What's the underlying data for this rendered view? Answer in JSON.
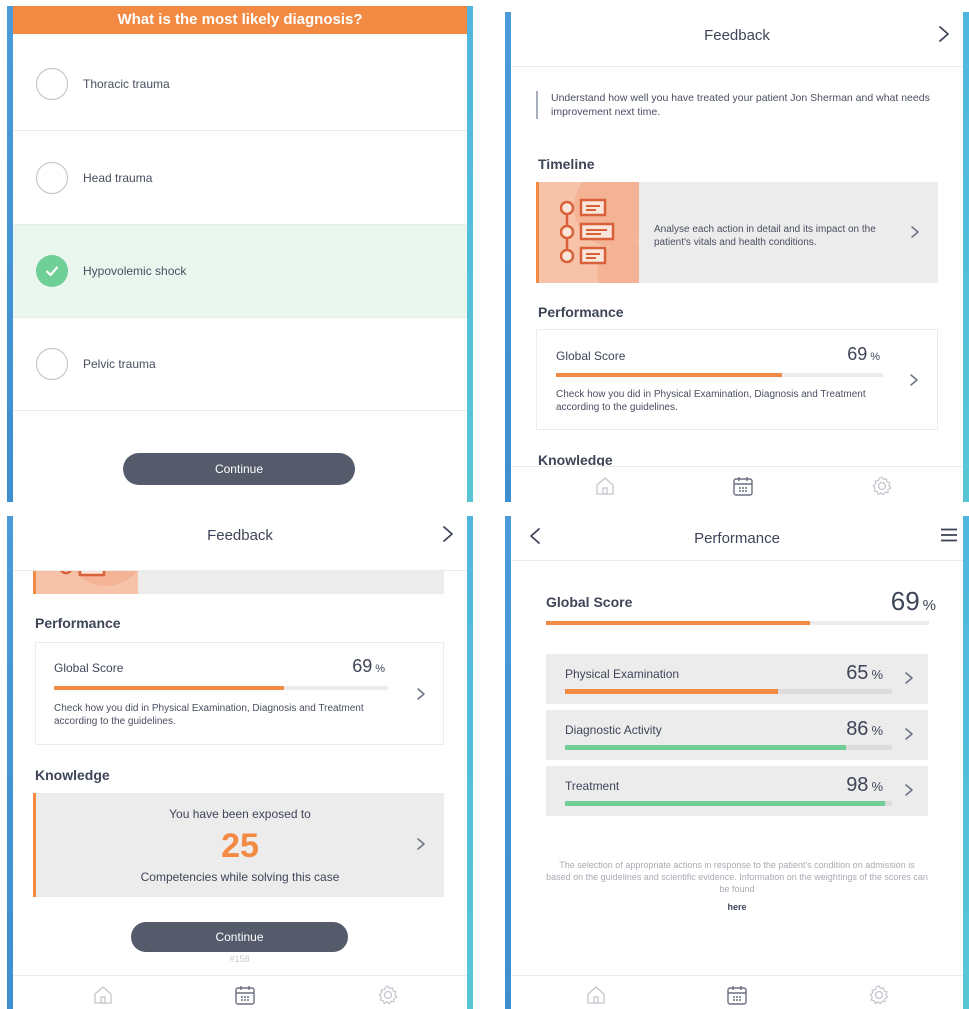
{
  "colors": {
    "accent": "#f28a44",
    "success": "#6fcf97",
    "button": "#555b6b",
    "card": "#ececec"
  },
  "quiz": {
    "question": "What is the most likely diagnosis?",
    "options": [
      {
        "label": "Thoracic trauma",
        "selected": false
      },
      {
        "label": "Head trauma",
        "selected": false
      },
      {
        "label": "Hypovolemic shock",
        "selected": true
      },
      {
        "label": "Pelvic trauma",
        "selected": false
      }
    ],
    "continue_label": "Continue"
  },
  "feedback": {
    "title": "Feedback",
    "intro": "Understand how well you have treated your patient Jon Sherman and what needs improvement next time.",
    "timeline_title": "Timeline",
    "timeline_text": "Analyse each action in detail and its impact on the patient's vitals and health conditions.",
    "performance_title": "Performance",
    "global_score_label": "Global Score",
    "global_score_value": "69",
    "global_score_fraction": 0.69,
    "percent_sign": "%",
    "global_score_desc": "Check how you did in Physical Examination, Diagnosis and Treatment according to the guidelines.",
    "knowledge_title": "Knowledge",
    "knowledge_line1": "You have been exposed to",
    "knowledge_count": "25",
    "knowledge_line2": "Competencies while solving this case",
    "continue_label": "Continue",
    "case_id": "#158"
  },
  "performance": {
    "title": "Performance",
    "global_label": "Global Score",
    "global_value": "69",
    "global_fraction": 0.69,
    "categories": [
      {
        "label": "Physical Examination",
        "value": "65",
        "fraction": 0.65,
        "color": "#f28a44"
      },
      {
        "label": "Diagnostic Activity",
        "value": "86",
        "fraction": 0.86,
        "color": "#6fcf97"
      },
      {
        "label": "Treatment",
        "value": "98",
        "fraction": 0.98,
        "color": "#6fcf97"
      }
    ],
    "footnote": "The selection of appropriate actions in response to the patient's condition on admission is based on the guidelines and scientific evidence. Information on the weightings of the scores can be found",
    "link_label": "here"
  },
  "tabbar": {
    "icons": [
      "home-icon",
      "calendar-icon",
      "settings-icon"
    ]
  }
}
